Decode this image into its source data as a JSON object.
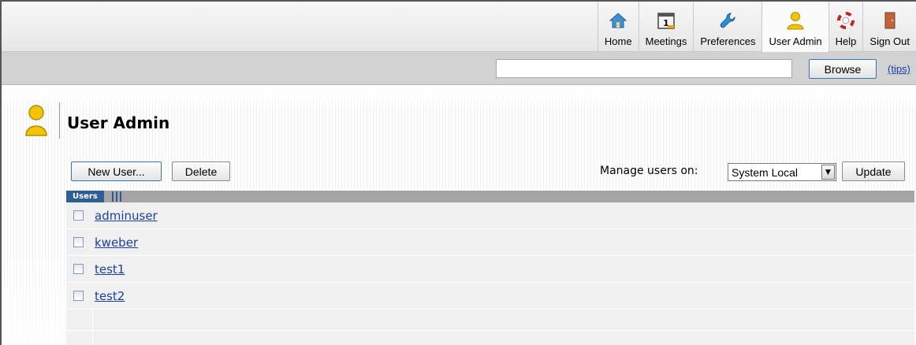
{
  "nav": {
    "items": [
      {
        "label": "Home",
        "icon": "home-icon"
      },
      {
        "label": "Meetings",
        "icon": "calendar-icon"
      },
      {
        "label": "Preferences",
        "icon": "wrench-icon"
      },
      {
        "label": "User Admin",
        "icon": "user-icon"
      },
      {
        "label": "Help",
        "icon": "lifebuoy-icon"
      },
      {
        "label": "Sign Out",
        "icon": "door-icon"
      }
    ]
  },
  "search": {
    "value": "",
    "browse_label": "Browse",
    "tips_label": "(tips)"
  },
  "page": {
    "title": "User Admin",
    "new_user_label": "New User...",
    "delete_label": "Delete",
    "manage_label": "Manage users on:",
    "manage_selected": "System Local",
    "update_label": "Update"
  },
  "users_table": {
    "tab_label": "Users",
    "rows": [
      "adminuser",
      "kweber",
      "test1",
      "test2"
    ]
  },
  "colors": {
    "link": "#1a3fa8",
    "header_tab": "#2f5d96",
    "user_icon": "#f2c200"
  }
}
